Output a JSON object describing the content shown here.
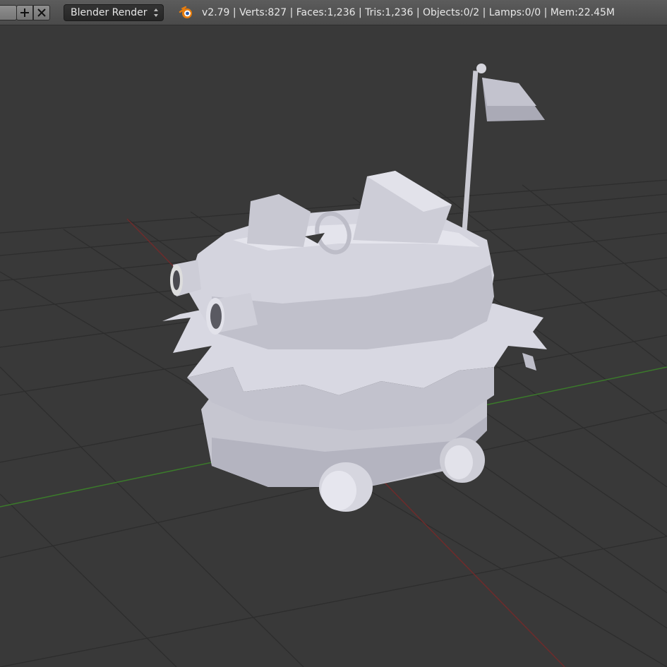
{
  "header": {
    "render_engine": "Blender Render",
    "stats": "v2.79 | Verts:827 | Faces:1,236 | Tris:1,236 | Objects:0/2 | Lamps:0/0 | Mem:22.45M"
  },
  "icons": {
    "add": "plus-icon",
    "remove": "x-icon",
    "blender": "blender-logo-icon",
    "dropdown": "updown-arrows-icon"
  },
  "colors": {
    "viewport_bg": "#393939",
    "grid": "#2c2c2c",
    "x_axis": "#7a2e2e",
    "y_axis": "#3f7a2c",
    "model": "#cfcfd8",
    "logo": "#e87d0d"
  }
}
